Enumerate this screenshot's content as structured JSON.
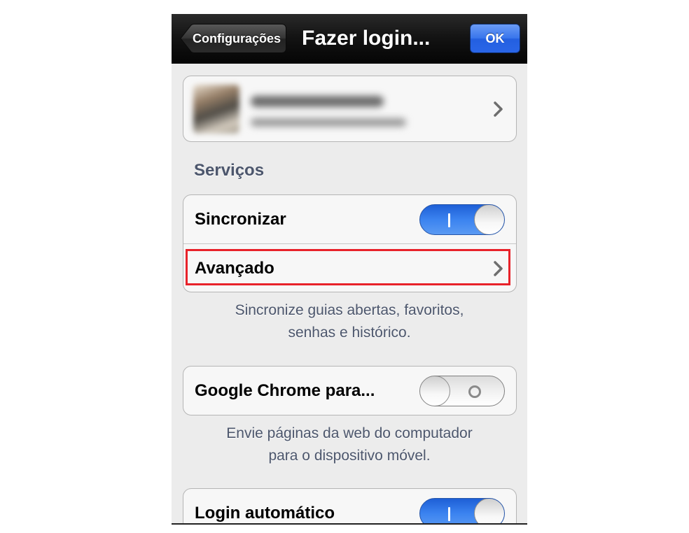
{
  "navbar": {
    "back_label": "Configurações",
    "title": "Fazer login...",
    "ok_label": "OK"
  },
  "account": {
    "chevron_icon": "chevron-right-icon"
  },
  "services": {
    "header": "Serviços",
    "sync_label": "Sincronizar",
    "sync_on": true,
    "advanced_label": "Avançado",
    "footer": "Sincronize guias abertas, favoritos,\nsenhas e histórico."
  },
  "chrome_to_mobile": {
    "label": "Google Chrome para...",
    "enabled": false,
    "footer": "Envie páginas da web do computador\npara o dispositivo móvel."
  },
  "auto_login": {
    "label": "Login automático",
    "enabled": true
  },
  "colors": {
    "highlight": "#e8222a",
    "switch_on": "#3b83f0",
    "ok_button": "#3774ec"
  }
}
